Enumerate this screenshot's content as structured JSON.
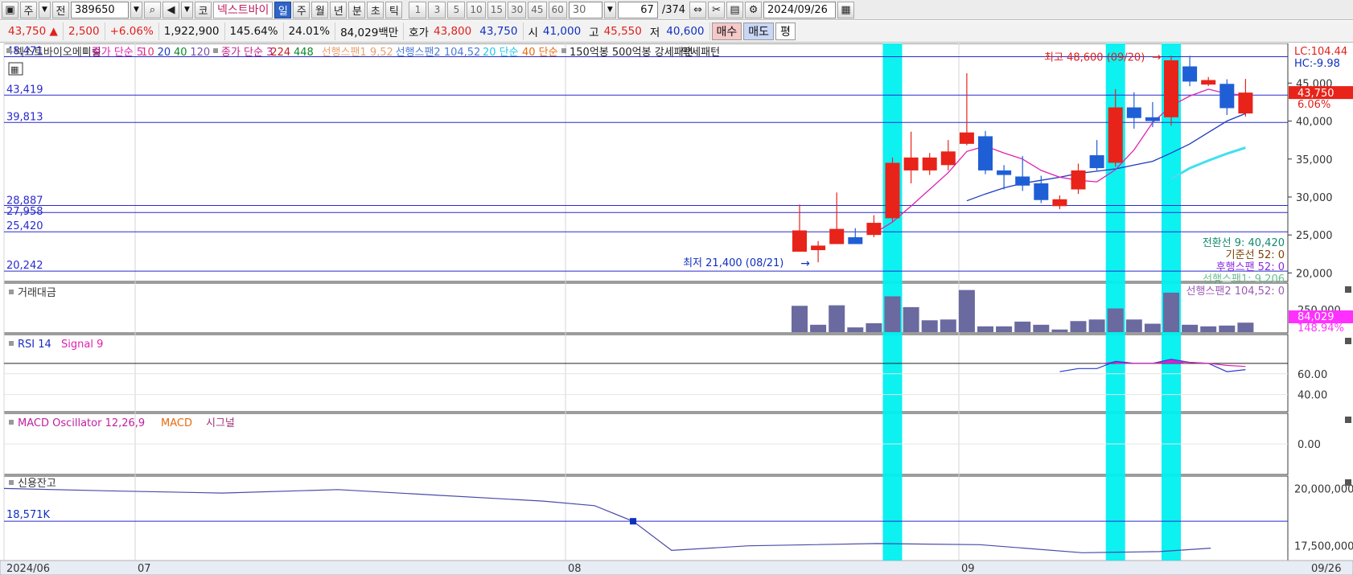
{
  "toolbar": {
    "period_label": "주",
    "prev_label": "전",
    "code_value": "389650",
    "market_label": "코",
    "stock_name": "넥스트바이",
    "timeframes": [
      "일",
      "주",
      "월",
      "년",
      "분",
      "초",
      "틱"
    ],
    "active_timeframe": "일",
    "intervals": [
      "1",
      "3",
      "5",
      "10",
      "15",
      "30",
      "45",
      "60"
    ],
    "interval_value": "30",
    "count_value": "67",
    "total_value": "/374",
    "date_value": "2024/09/26"
  },
  "quote": {
    "price": "43,750",
    "change": "2,500",
    "change_pct": "+6.06%",
    "volume": "1,922,900",
    "vol_ratio": "145.64%",
    "turnover": "24.01%",
    "amount": "84,029백만",
    "hoga_label": "호가",
    "ask": "43,800",
    "bid": "43,750",
    "open_label": "시",
    "open": "41,000",
    "high_label": "고",
    "high": "45,550",
    "low_label": "저",
    "low": "40,600",
    "buy_label": "매수",
    "sell_label": "매도",
    "eval_label": "평"
  },
  "legend": {
    "title": "넥스트바이오메디컬",
    "ma5": "종가 단순 5",
    "ma_rest": [
      "10",
      "20",
      "40",
      "120"
    ],
    "ma3": "종가 단순 3",
    "ma3_rest": [
      "224",
      "448"
    ],
    "span1": "선행스팬1 9,52",
    "span2": "선행스팬2 104,52",
    "s20": "20 단순",
    "s40": "40 단순",
    "pattern": "150억봉 500억봉 강세패턴",
    "weak": "약세패턴"
  },
  "price_panel": {
    "ymin": 19300,
    "ymax": 49800,
    "hlines": [
      {
        "label": "48,471",
        "value": 48471
      },
      {
        "label": "43,419",
        "value": 43419
      },
      {
        "label": "39,813",
        "value": 39813
      },
      {
        "label": "28,887",
        "value": 28887
      },
      {
        "label": "27,958",
        "value": 27958
      },
      {
        "label": "25,420",
        "value": 25420
      },
      {
        "label": "20,242",
        "value": 20242
      }
    ],
    "axis_ticks": [
      {
        "label": "45,000",
        "value": 45000
      },
      {
        "label": "40,000",
        "value": 40000
      },
      {
        "label": "35,000",
        "value": 35000
      },
      {
        "label": "30,000",
        "value": 30000
      },
      {
        "label": "25,000",
        "value": 25000
      },
      {
        "label": "20,000",
        "value": 20000
      }
    ],
    "lc_label": "LC:104.44",
    "hc_label": "HC:-9.98",
    "current_label": "43,750",
    "current_pct": "6.06%",
    "max_annotation": "최고 48,600 (09/20)",
    "min_annotation": "최저 21,400 (08/21)",
    "ichimoku": [
      {
        "label": "전환선 9: 40,420",
        "color": "#138a6e"
      },
      {
        "label": "기준선 52: 0",
        "color": "#7b3f00"
      },
      {
        "label": "후행스팬 52: 0",
        "color": "#8a2be2"
      },
      {
        "label": "선행스팬1: 9,206",
        "color": "#6bbf8e"
      },
      {
        "label": "선행스팬2 104,52: 0",
        "color": "#9b59b6"
      }
    ]
  },
  "volume_panel": {
    "label": "거래대금",
    "ticks": [
      {
        "label": "250,000",
        "value": 250000
      }
    ],
    "current_label": "84,029",
    "current_pct": "148.94%"
  },
  "rsi_panel": {
    "label": "RSI 14",
    "signal_label": "Signal 9",
    "ticks": [
      {
        "label": "60.00",
        "value": 60
      },
      {
        "label": "40.00",
        "value": 40
      }
    ]
  },
  "macd_panel": {
    "osc_label": "MACD Oscillator 12,26,9",
    "macd_label": "MACD",
    "signal_label": "시그널",
    "ticks": [
      {
        "label": "0.00",
        "value": 0
      }
    ]
  },
  "credit_panel": {
    "label": "신용잔고",
    "value_label": "18,571K",
    "ticks": [
      {
        "label": "20,000,000",
        "value": 20000000
      },
      {
        "label": "17,500,000",
        "value": 17500000
      }
    ]
  },
  "xaxis": {
    "labels": [
      "2024/06",
      "07",
      "08",
      "09"
    ],
    "end_label": "09/26"
  },
  "colors": {
    "up": "#e8231a",
    "down": "#1f5fd6",
    "highlight": "#00f0f0",
    "volume": "#6a6aa0",
    "hline": "#2a2acd",
    "ma5": "#e020b0",
    "ma20": "#1a3cc0",
    "ma40": "#40e0f0"
  },
  "chart_data": {
    "type": "candlestick",
    "candles": [
      {
        "o": 22800,
        "h": 29000,
        "l": 22800,
        "c": 25600,
        "vol": 100
      },
      {
        "o": 23000,
        "h": 24200,
        "l": 21400,
        "c": 23600,
        "vol": 28
      },
      {
        "o": 23800,
        "h": 30600,
        "l": 23800,
        "c": 25800,
        "vol": 102
      },
      {
        "o": 24700,
        "h": 25900,
        "l": 23800,
        "c": 23800,
        "vol": 18
      },
      {
        "o": 25000,
        "h": 27600,
        "l": 24700,
        "c": 26600,
        "vol": 34
      },
      {
        "o": 27200,
        "h": 35200,
        "l": 26800,
        "c": 34500,
        "vol": 136
      },
      {
        "o": 33500,
        "h": 38600,
        "l": 31800,
        "c": 35200,
        "vol": 95
      },
      {
        "o": 33500,
        "h": 35800,
        "l": 32900,
        "c": 35200,
        "vol": 45
      },
      {
        "o": 34200,
        "h": 37500,
        "l": 33500,
        "c": 36000,
        "vol": 48
      },
      {
        "o": 37000,
        "h": 46300,
        "l": 36800,
        "c": 38500,
        "vol": 160
      },
      {
        "o": 38000,
        "h": 38700,
        "l": 33000,
        "c": 33500,
        "vol": 22
      },
      {
        "o": 33500,
        "h": 34200,
        "l": 31000,
        "c": 32900,
        "vol": 22
      },
      {
        "o": 32700,
        "h": 35400,
        "l": 30800,
        "c": 31500,
        "vol": 40
      },
      {
        "o": 31800,
        "h": 32800,
        "l": 29200,
        "c": 29600,
        "vol": 28
      },
      {
        "o": 28800,
        "h": 30200,
        "l": 28400,
        "c": 29700,
        "vol": 10
      },
      {
        "o": 31000,
        "h": 34400,
        "l": 30400,
        "c": 33500,
        "vol": 42
      },
      {
        "o": 35500,
        "h": 37500,
        "l": 33500,
        "c": 33800,
        "vol": 48
      },
      {
        "o": 34500,
        "h": 44200,
        "l": 34000,
        "c": 41800,
        "vol": 90
      },
      {
        "o": 41800,
        "h": 43800,
        "l": 39000,
        "c": 40400,
        "vol": 48
      },
      {
        "o": 40500,
        "h": 42500,
        "l": 39200,
        "c": 40000,
        "vol": 32
      },
      {
        "o": 40500,
        "h": 48600,
        "l": 39400,
        "c": 48000,
        "vol": 150
      },
      {
        "o": 47200,
        "h": 48600,
        "l": 44600,
        "c": 45200,
        "vol": 28
      },
      {
        "o": 44800,
        "h": 45800,
        "l": 44600,
        "c": 45400,
        "vol": 22
      },
      {
        "o": 44900,
        "h": 45500,
        "l": 40800,
        "c": 41700,
        "vol": 25
      },
      {
        "o": 41000,
        "h": 45550,
        "l": 40600,
        "c": 43750,
        "vol": 36
      }
    ],
    "highlight_indices": [
      5,
      17,
      20
    ],
    "ma5": [
      null,
      null,
      null,
      null,
      25200,
      26700,
      28800,
      31000,
      33200,
      36000,
      36700,
      35800,
      35000,
      33500,
      32600,
      32200,
      32000,
      33600,
      36200,
      39800,
      42000,
      43300,
      44200,
      43600,
      43400
    ],
    "ma20": [
      null,
      null,
      null,
      null,
      null,
      null,
      null,
      null,
      null,
      29500,
      30400,
      31200,
      31800,
      32200,
      32600,
      33100,
      33400,
      33700,
      34200,
      34700,
      35800,
      37000,
      38500,
      40000,
      41000
    ],
    "ma40": [
      null,
      null,
      null,
      null,
      null,
      null,
      null,
      null,
      null,
      null,
      null,
      null,
      null,
      null,
      null,
      null,
      null,
      null,
      null,
      null,
      32400,
      33800,
      34800,
      35700,
      36500
    ],
    "rsi": [
      null,
      null,
      null,
      null,
      null,
      null,
      null,
      null,
      null,
      null,
      null,
      null,
      null,
      null,
      62,
      65,
      65,
      72,
      70,
      70,
      74,
      71,
      70,
      62,
      64
    ],
    "rsi_signal": [
      null,
      null,
      null,
      null,
      null,
      null,
      null,
      null,
      null,
      null,
      null,
      null,
      null,
      null,
      null,
      null,
      null,
      70,
      70,
      70,
      72,
      71,
      70,
      68,
      67
    ],
    "credit": [
      {
        "x": 0.0,
        "v": 20000000
      },
      {
        "x": 0.08,
        "v": 19900000
      },
      {
        "x": 0.17,
        "v": 19800000
      },
      {
        "x": 0.26,
        "v": 19950000
      },
      {
        "x": 0.34,
        "v": 19700000
      },
      {
        "x": 0.42,
        "v": 19450000
      },
      {
        "x": 0.46,
        "v": 19250000
      },
      {
        "x": 0.49,
        "v": 18571000
      },
      {
        "x": 0.52,
        "v": 17300000
      },
      {
        "x": 0.58,
        "v": 17500000
      },
      {
        "x": 0.68,
        "v": 17600000
      },
      {
        "x": 0.76,
        "v": 17550000
      },
      {
        "x": 0.84,
        "v": 17200000
      },
      {
        "x": 0.9,
        "v": 17250000
      },
      {
        "x": 0.94,
        "v": 17400000
      }
    ]
  }
}
